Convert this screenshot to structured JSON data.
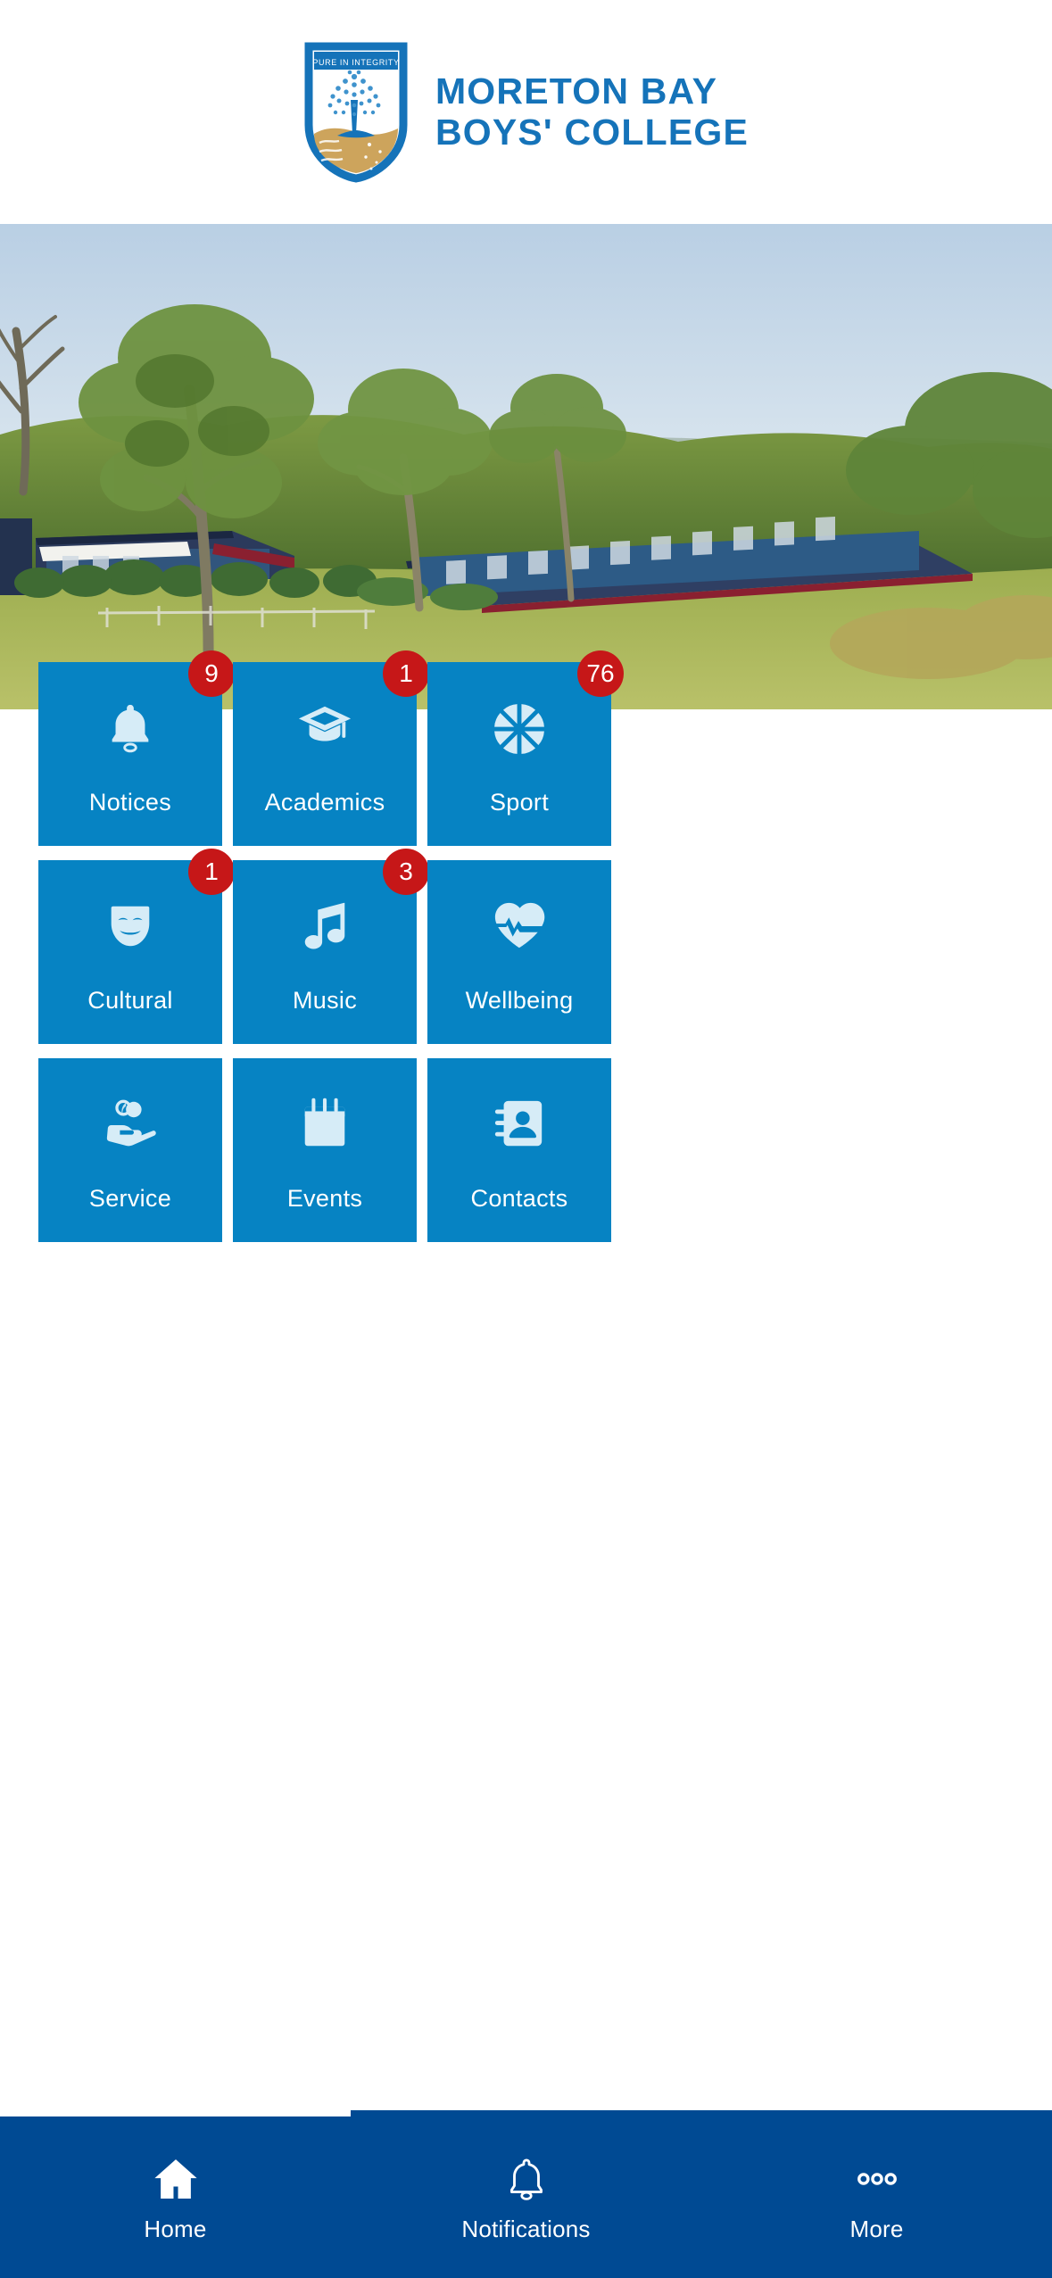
{
  "header": {
    "school_name_line1": "MORETON BAY",
    "school_name_line2": "BOYS' COLLEGE",
    "wordmark": "MORETON BAY\nBOYS' COLLEGE",
    "logo_motto": "PURE IN INTEGRITY",
    "logo_icon": "shield-tree-crest-icon"
  },
  "hero": {
    "alt": "school-campus-photo",
    "description": "Aerial view of school campus buildings with blue roofs surrounded by gum trees and grass"
  },
  "colors": {
    "tile_blue": "#0683c3",
    "badge_red": "#c61718",
    "nav_navy": "#004a93",
    "brand_blue": "#1573b9",
    "icon_tint": "#d6ecf7",
    "crest_sand": "#cfa котор"
  },
  "grid": {
    "tiles": [
      {
        "label": "Notices",
        "icon": "bell-icon",
        "badge": "9",
        "has_badge": true
      },
      {
        "label": "Academics",
        "icon": "graduation-cap-icon",
        "badge": "1",
        "has_badge": true
      },
      {
        "label": "Sport",
        "icon": "basketball-icon",
        "badge": "76",
        "has_badge": true
      },
      {
        "label": "Cultural",
        "icon": "theater-mask-icon",
        "badge": "1",
        "has_badge": true
      },
      {
        "label": "Music",
        "icon": "music-note-icon",
        "badge": "3",
        "has_badge": true
      },
      {
        "label": "Wellbeing",
        "icon": "heart-pulse-icon",
        "badge": "",
        "has_badge": false
      },
      {
        "label": "Service",
        "icon": "helping-hand-icon",
        "badge": "",
        "has_badge": false
      },
      {
        "label": "Events",
        "icon": "calendar-icon",
        "badge": "",
        "has_badge": false
      },
      {
        "label": "Contacts",
        "icon": "address-book-icon",
        "badge": "",
        "has_badge": false
      }
    ]
  },
  "bottom_nav": {
    "items": [
      {
        "label": "Home",
        "icon": "home-icon",
        "active": true
      },
      {
        "label": "Notifications",
        "icon": "bell-icon",
        "active": false
      },
      {
        "label": "More",
        "icon": "ellipsis-icon",
        "active": false
      }
    ]
  }
}
